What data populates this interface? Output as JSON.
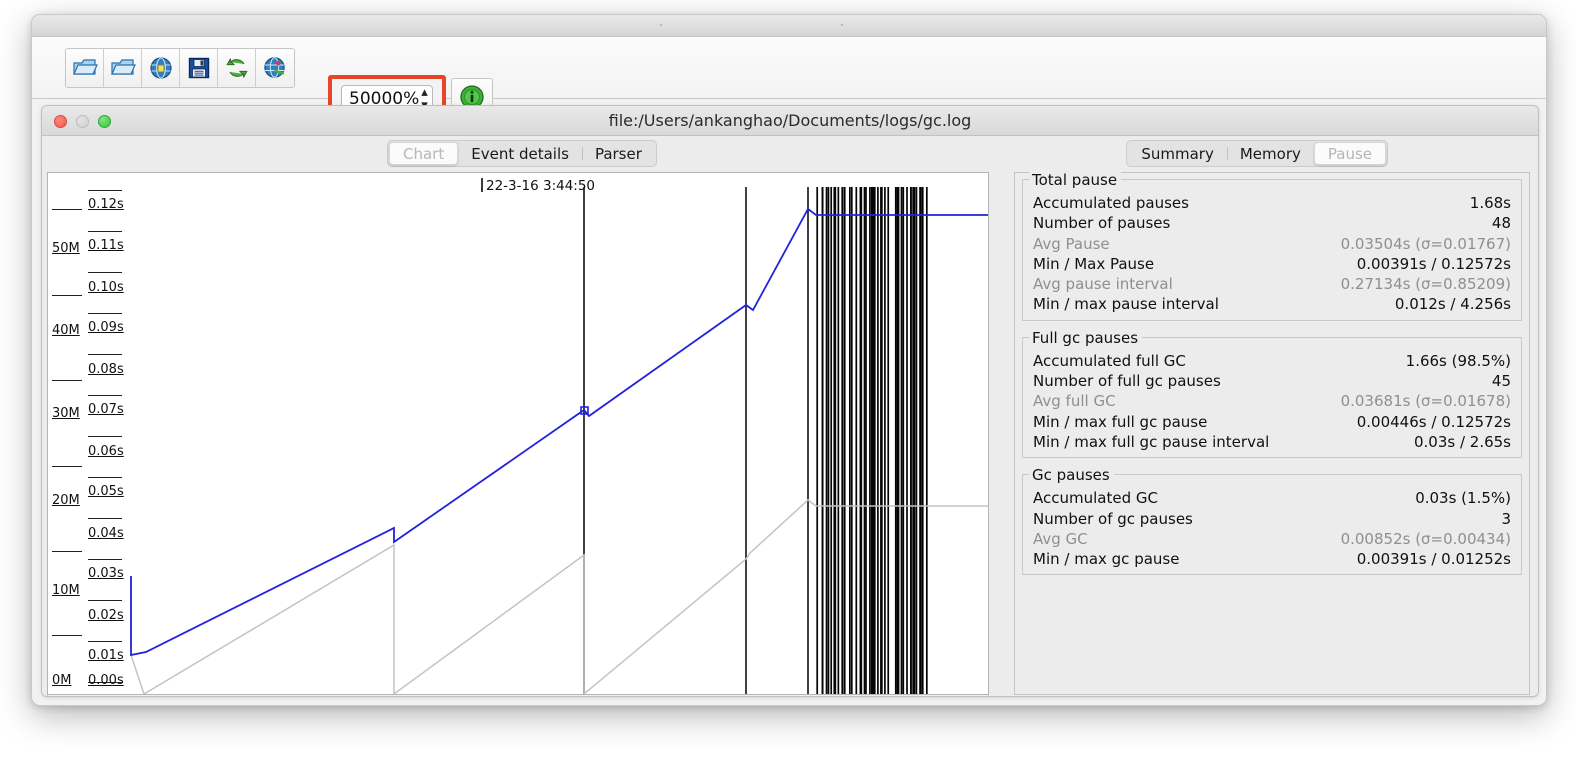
{
  "toolbar": {
    "buttons": [
      {
        "name": "open-folder-icon",
        "title": "Open"
      },
      {
        "name": "open-folder-series-icon",
        "title": "Open series"
      },
      {
        "name": "globe-open-url-icon",
        "title": "Open URL"
      },
      {
        "name": "save-floppy-icon",
        "title": "Save"
      },
      {
        "name": "refresh-arrows-icon",
        "title": "Refresh"
      },
      {
        "name": "globe-watch-icon",
        "title": "Watch"
      }
    ],
    "zoom_value": "50000%",
    "zoom_stepper_up": "▴",
    "zoom_stepper_down": "▾",
    "info_button_name": "info-icon",
    "highlight_color": "#e8442a"
  },
  "document_window": {
    "title": "file:/Users/ankanghao/Documents/logs/gc.log",
    "traffic_lights": [
      "close",
      "minimize",
      "maximize"
    ]
  },
  "left_tabs": [
    {
      "label": "Chart",
      "selected": true
    },
    {
      "label": "Event details",
      "selected": false
    },
    {
      "label": "Parser",
      "selected": false
    }
  ],
  "right_tabs": [
    {
      "label": "Summary",
      "selected": false
    },
    {
      "label": "Memory",
      "selected": false
    },
    {
      "label": "Pause",
      "selected": true
    }
  ],
  "chart": {
    "timestamp_label": "22-3-16 3:44:50",
    "memory_axis_labels": [
      "50M",
      "40M",
      "30M",
      "20M",
      "10M",
      "0M"
    ],
    "time_axis_labels": [
      "0.12s",
      "0.11s",
      "0.10s",
      "0.09s",
      "0.08s",
      "0.07s",
      "0.06s",
      "0.05s",
      "0.04s",
      "0.03s",
      "0.02s",
      "0.01s",
      "0.00s"
    ],
    "series": [
      {
        "name": "total-heap",
        "color": "#2222dd"
      },
      {
        "name": "used-heap",
        "color": "#bfbfbf"
      },
      {
        "name": "full-gc-pauses",
        "color": "#000000"
      }
    ]
  },
  "chart_data": {
    "type": "line",
    "title": "",
    "xlabel": "",
    "ylabel": "",
    "annotations": [
      "22-3-16 3:44:50"
    ],
    "y_axis_memory": {
      "ticks": [
        "0M",
        "10M",
        "20M",
        "30M",
        "40M",
        "50M"
      ],
      "range": [
        0,
        55
      ]
    },
    "y_axis_pause": {
      "ticks": [
        "0.00s",
        "0.01s",
        "0.02s",
        "0.03s",
        "0.04s",
        "0.05s",
        "0.06s",
        "0.07s",
        "0.08s",
        "0.09s",
        "0.10s",
        "0.11s",
        "0.12s"
      ],
      "range": [
        0,
        0.13
      ]
    },
    "series": [
      {
        "name": "total-heap",
        "color": "#2222dd",
        "x": [
          0,
          0,
          2,
          34,
          34,
          57,
          57,
          74,
          74,
          79,
          79,
          100
        ],
        "y": [
          0.03,
          0.0105,
          0.0105,
          0.0425,
          0.039,
          0.0705,
          0.069,
          0.1025,
          0.101,
          0.1175,
          0.116,
          0.116
        ]
      },
      {
        "name": "used-heap",
        "color": "#bfbfbf",
        "x": [
          0,
          2,
          36,
          36,
          57,
          57,
          74,
          74,
          79,
          79,
          100
        ],
        "y": [
          0.01,
          0.0005,
          0.0385,
          0.0,
          0.033,
          0.0,
          0.028,
          0.0285,
          0.032,
          0.03,
          0.03
        ]
      }
    ],
    "vertical_event_lines": {
      "color": "#000000",
      "sparse_x": [
        57.5,
        74.5,
        79.0
      ],
      "dense_band": {
        "x_start": 80.0,
        "x_end": 92.8,
        "count": 45
      }
    },
    "markers": [
      {
        "x": 57.6,
        "y": 0.0695,
        "shape": "square",
        "series": "total-heap"
      }
    ],
    "grid": false,
    "legend": "none"
  },
  "stats": {
    "groups": [
      {
        "legend": "Total pause",
        "rows": [
          {
            "label": "Accumulated pauses",
            "value": "1.68s",
            "dim": false
          },
          {
            "label": "Number of pauses",
            "value": "48",
            "dim": false
          },
          {
            "label": "Avg Pause",
            "value": "0.03504s (σ=0.01767)",
            "dim": true
          },
          {
            "label": "Min / Max Pause",
            "value": "0.00391s / 0.12572s",
            "dim": false
          },
          {
            "label": "Avg pause interval",
            "value": "0.27134s (σ=0.85209)",
            "dim": true
          },
          {
            "label": "Min / max pause interval",
            "value": "0.012s / 4.256s",
            "dim": false
          }
        ]
      },
      {
        "legend": "Full gc pauses",
        "rows": [
          {
            "label": "Accumulated full GC",
            "value": "1.66s (98.5%)",
            "dim": false
          },
          {
            "label": "Number of full gc pauses",
            "value": "45",
            "dim": false
          },
          {
            "label": "Avg full GC",
            "value": "0.03681s (σ=0.01678)",
            "dim": true
          },
          {
            "label": "Min / max full gc pause",
            "value": "0.00446s / 0.12572s",
            "dim": false
          },
          {
            "label": "Min / max full gc pause interval",
            "value": "0.03s / 2.65s",
            "dim": false
          }
        ]
      },
      {
        "legend": "Gc pauses",
        "rows": [
          {
            "label": "Accumulated GC",
            "value": "0.03s (1.5%)",
            "dim": false
          },
          {
            "label": "Number of gc pauses",
            "value": "3",
            "dim": false
          },
          {
            "label": "Avg GC",
            "value": "0.00852s (σ=0.00434)",
            "dim": true
          },
          {
            "label": "Min / max gc pause",
            "value": "0.00391s / 0.01252s",
            "dim": false
          }
        ]
      }
    ]
  }
}
